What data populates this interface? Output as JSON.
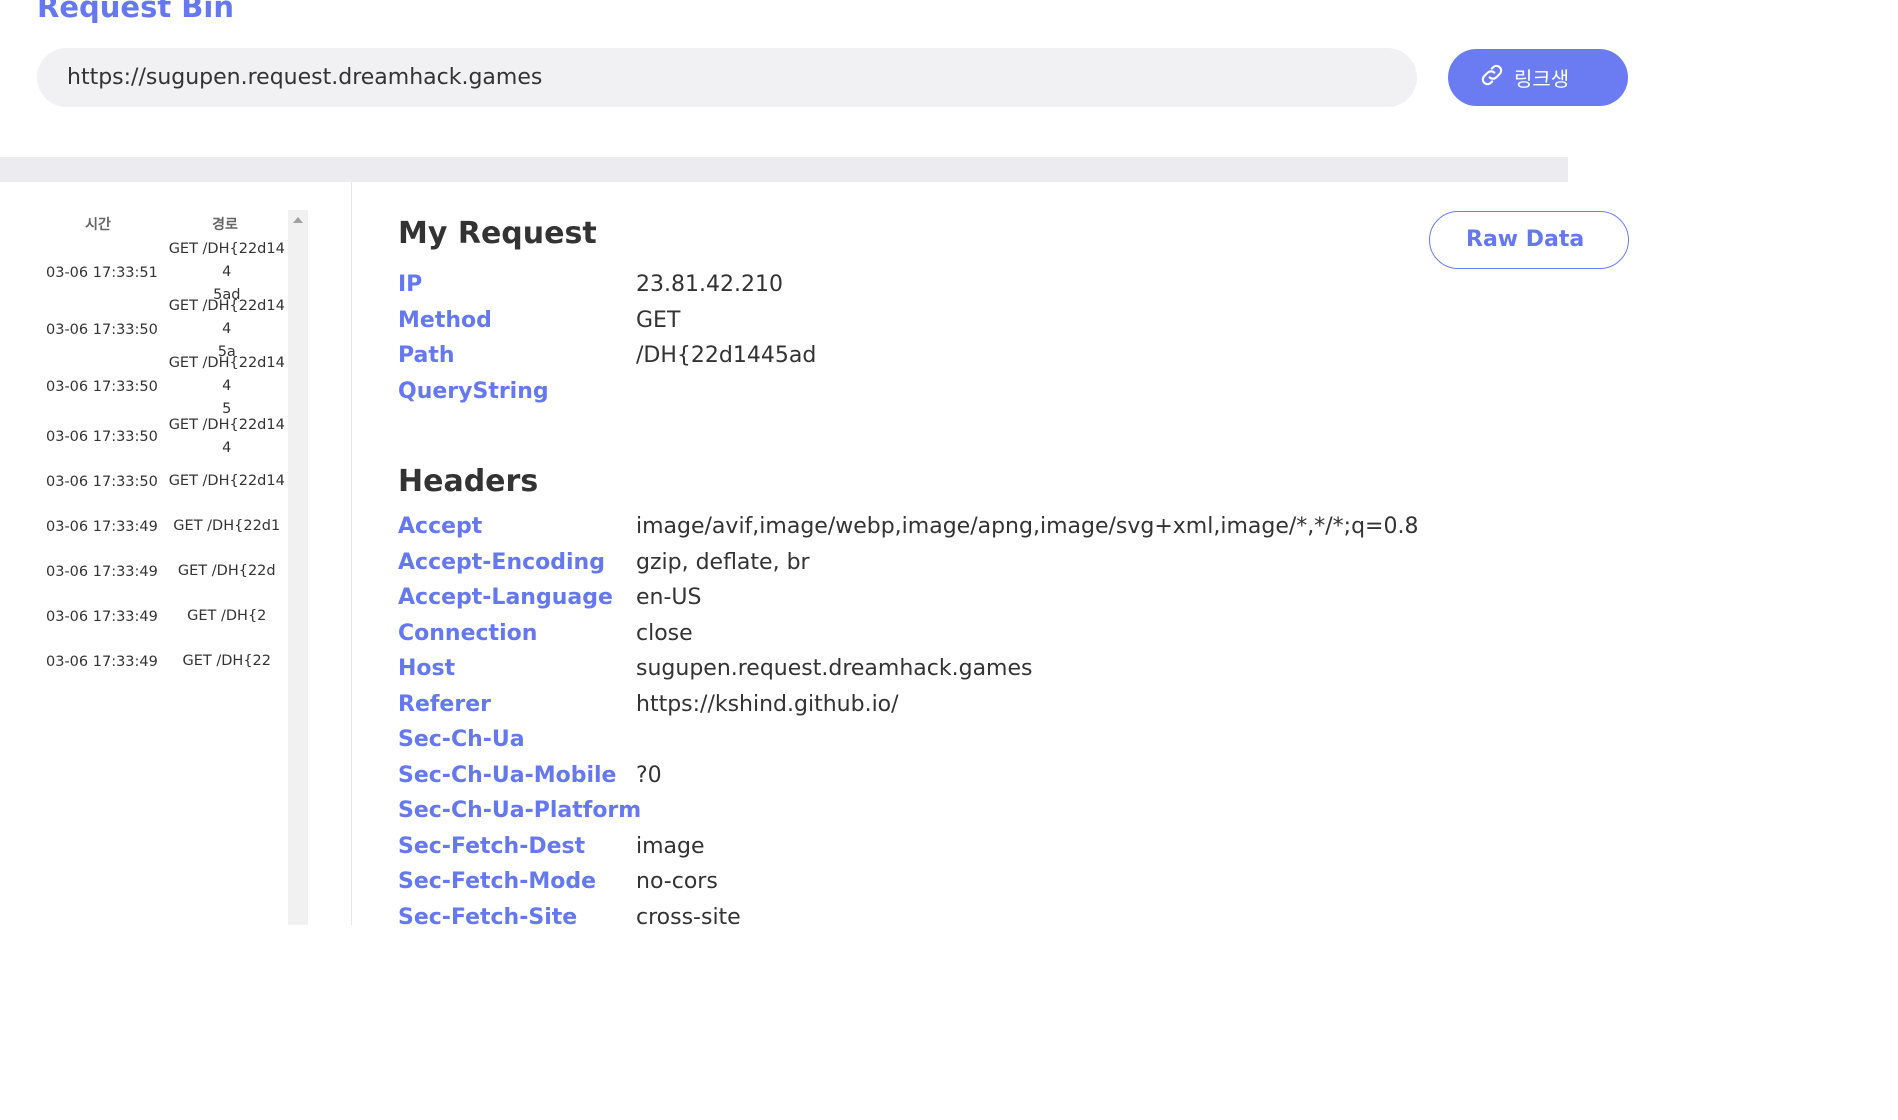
{
  "app": {
    "title": "Request Bin"
  },
  "url_bar": {
    "value": "https://sugupen.request.dreamhack.games"
  },
  "link_button": {
    "label": "링크생"
  },
  "raw_button": {
    "label": "Raw Data"
  },
  "request_list": {
    "headers": {
      "time": "시간",
      "path": "경로"
    },
    "rows": [
      {
        "time": "03-06 17:33:51",
        "path": "GET /DH{22d144\n5ad"
      },
      {
        "time": "03-06 17:33:50",
        "path": "GET /DH{22d144\n5a"
      },
      {
        "time": "03-06 17:33:50",
        "path": "GET /DH{22d144\n5"
      },
      {
        "time": "03-06 17:33:50",
        "path": "GET /DH{22d144"
      },
      {
        "time": "03-06 17:33:50",
        "path": "GET /DH{22d14"
      },
      {
        "time": "03-06 17:33:49",
        "path": "GET /DH{22d1"
      },
      {
        "time": "03-06 17:33:49",
        "path": "GET /DH{22d"
      },
      {
        "time": "03-06 17:33:49",
        "path": "GET /DH{2"
      },
      {
        "time": "03-06 17:33:49",
        "path": "GET /DH{22"
      }
    ]
  },
  "my_request": {
    "title": "My Request",
    "fields": [
      {
        "key": "IP",
        "value": "23.81.42.210"
      },
      {
        "key": "Method",
        "value": "GET"
      },
      {
        "key": "Path",
        "value": "/DH{22d1445ad"
      },
      {
        "key": "QueryString",
        "value": ""
      }
    ]
  },
  "headers": {
    "title": "Headers",
    "fields": [
      {
        "key": "Accept",
        "value": "image/avif,image/webp,image/apng,image/svg+xml,image/*,*/*;q=0.8"
      },
      {
        "key": "Accept-Encoding",
        "value": "gzip, deflate, br"
      },
      {
        "key": "Accept-Language",
        "value": "en-US"
      },
      {
        "key": "Connection",
        "value": "close"
      },
      {
        "key": "Host",
        "value": "sugupen.request.dreamhack.games"
      },
      {
        "key": "Referer",
        "value": "https://kshind.github.io/"
      },
      {
        "key": "Sec-Ch-Ua",
        "value": ""
      },
      {
        "key": "Sec-Ch-Ua-Mobile",
        "value": "?0"
      },
      {
        "key": "Sec-Ch-Ua-Platform",
        "value": ""
      },
      {
        "key": "Sec-Fetch-Dest",
        "value": "image"
      },
      {
        "key": "Sec-Fetch-Mode",
        "value": "no-cors"
      },
      {
        "key": "Sec-Fetch-Site",
        "value": "cross-site"
      }
    ]
  },
  "colors": {
    "accent": "#6678f0",
    "button_bg": "#6b7cf2",
    "band": "#ececf0"
  }
}
